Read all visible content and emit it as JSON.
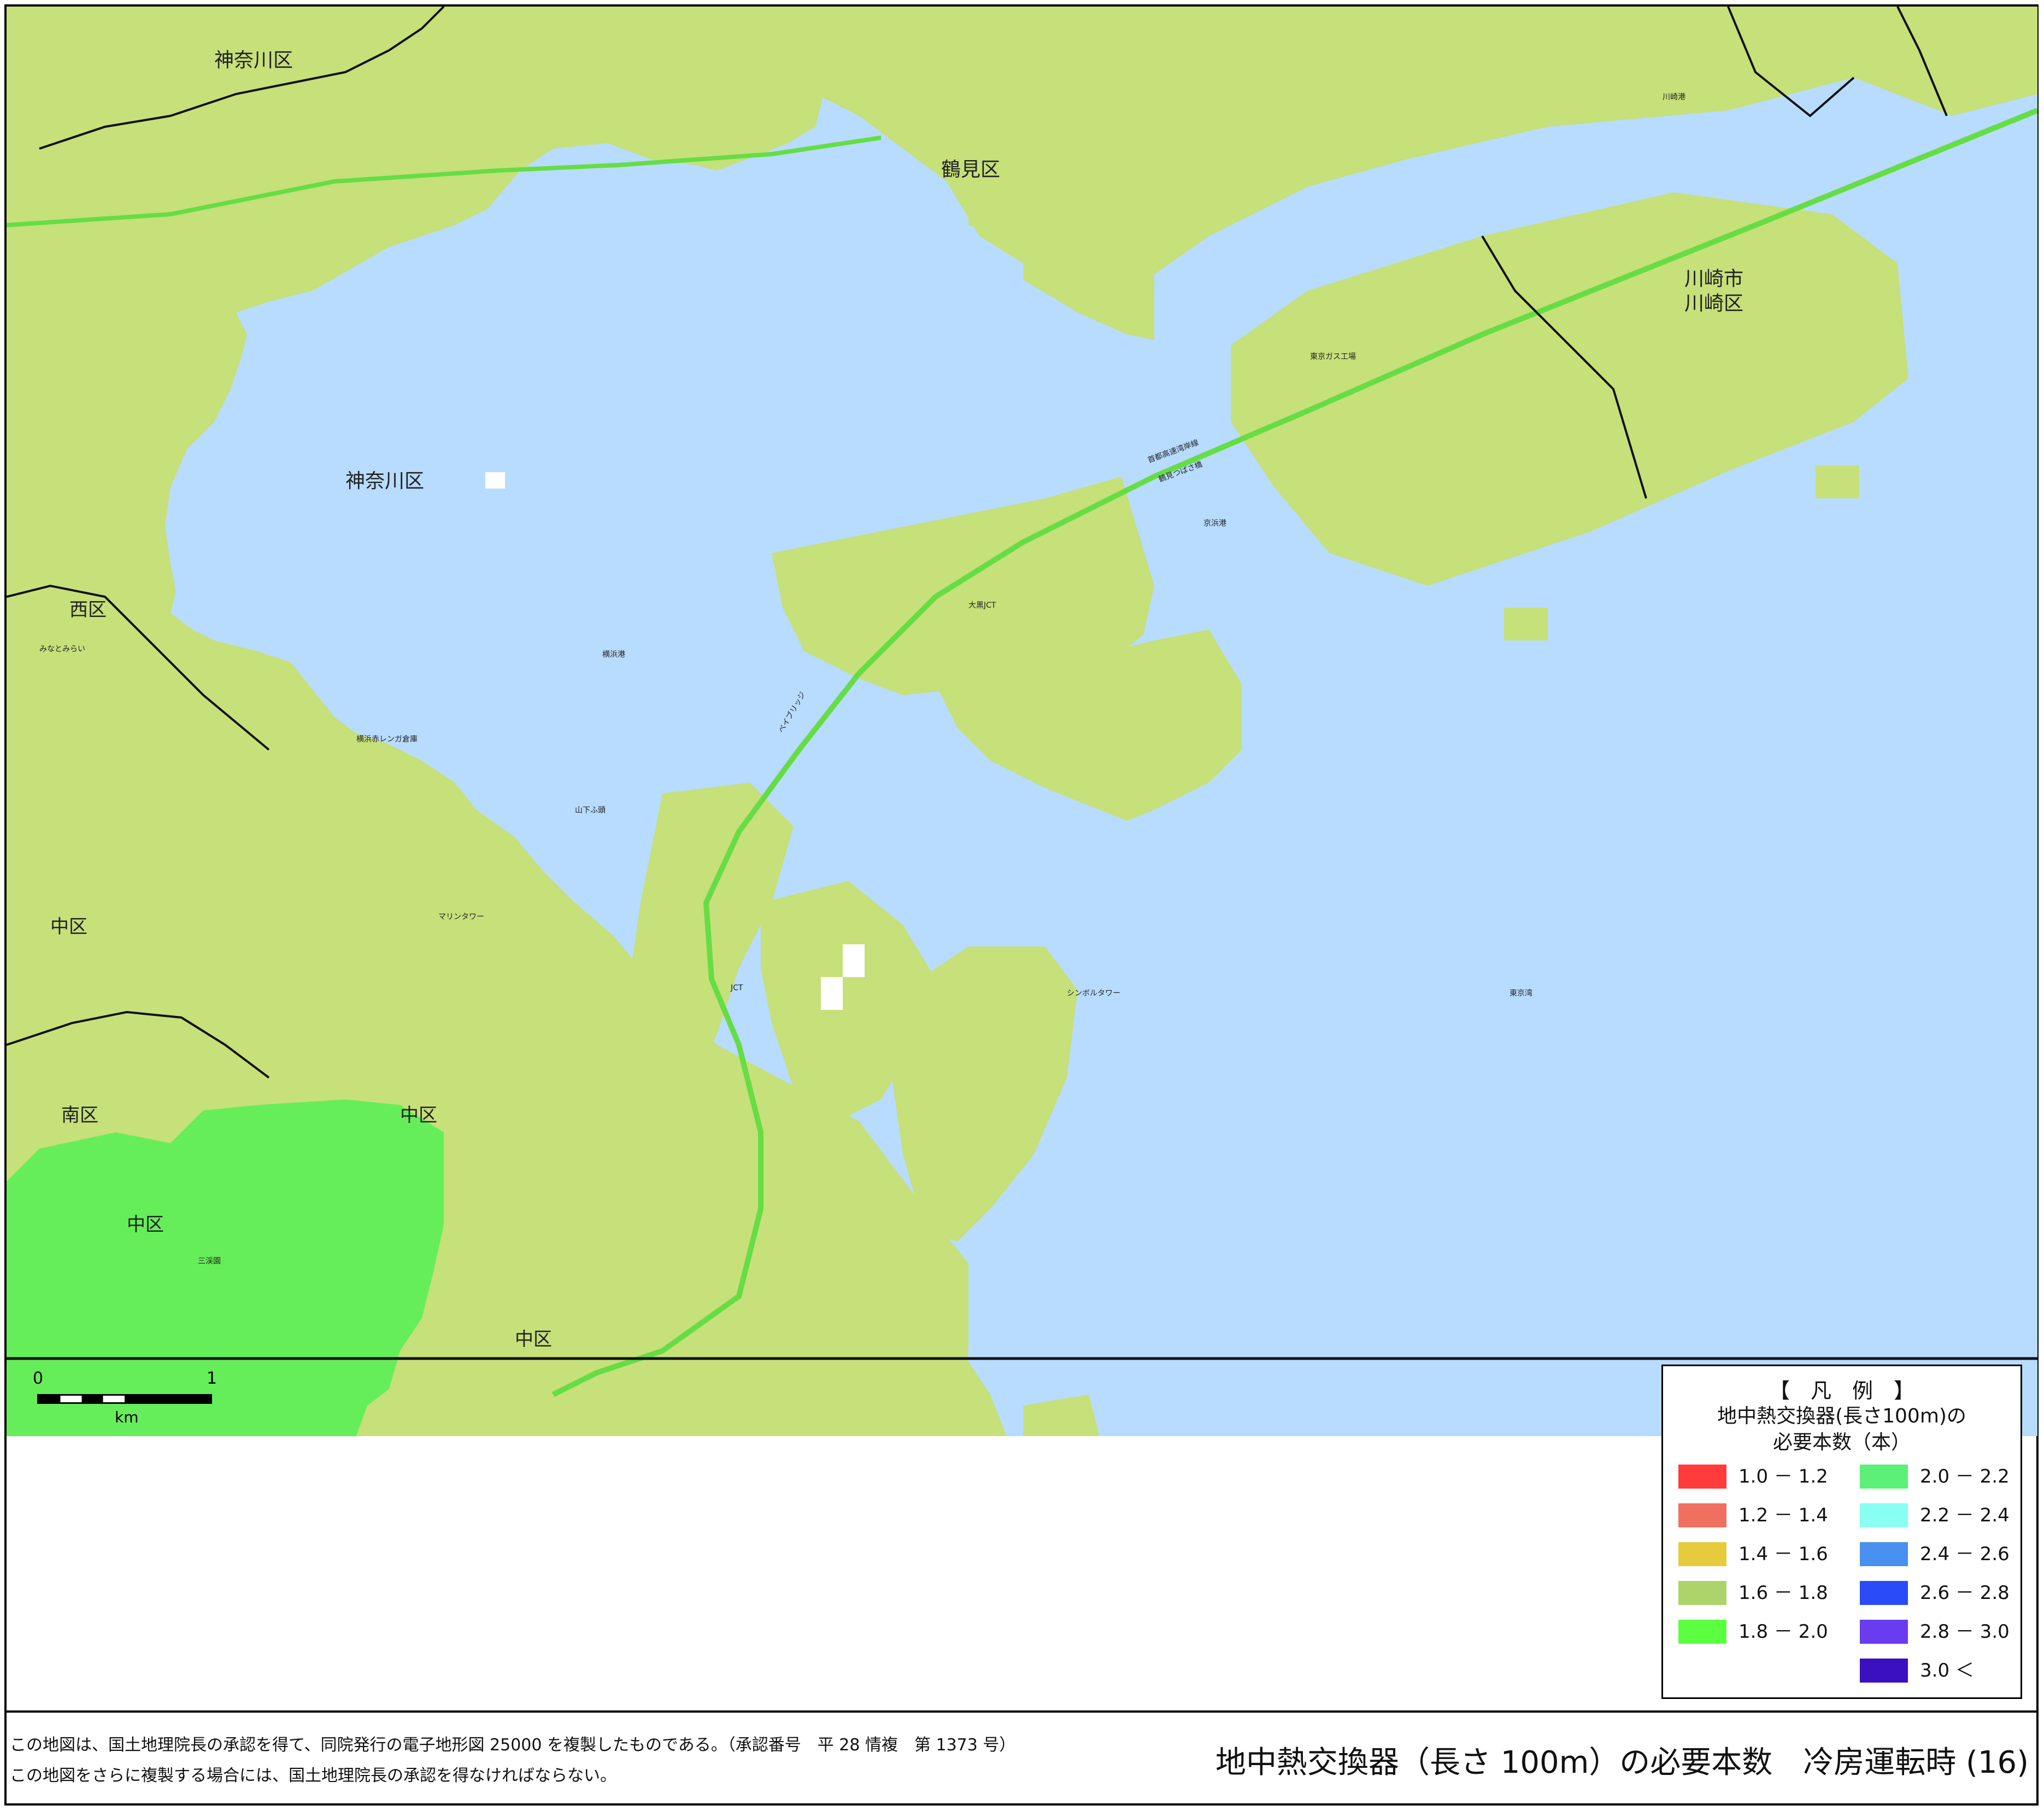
{
  "map": {
    "colors": {
      "land": "#c6e07a",
      "water": "#b7dcff",
      "zone_green": "#66ee5a",
      "boundary": "#111111",
      "expressway": "#66dd44"
    },
    "place_labels": {
      "kanagawa_north": "神奈川区",
      "kanagawa_port": "神奈川区",
      "tsurumi": "鶴見区",
      "kawasaki_city": "川崎市",
      "kawasaki_ward": "川崎区",
      "nishi": "西区",
      "naka_west": "中区",
      "minami": "南区",
      "naka_mid": "中区",
      "naka_park": "中区",
      "naka_south": "中区"
    },
    "small_labels": {
      "tokyo_bay": "東京湾",
      "keihin_port": "京浜港",
      "yokohama_port": "横浜港",
      "bay_bridge": "ベイブリッジ",
      "marine_tower": "マリンタワー",
      "symbol_tower": "シンボルタワー",
      "daikoku_jct": "大黒JCT",
      "honmoku_jct": "JCT",
      "shuto_bayshore": "首都高速湾岸線",
      "tsubasa_bridge": "鶴見つばさ橋",
      "kawasaki_port": "川崎港",
      "tokyo_gas": "東京ガス工場",
      "yamashita_pier": "山下ふ頭",
      "red_brick": "横浜赤レンガ倉庫",
      "minato_mirai": "みなとみらい",
      "sankeien": "三渓園"
    }
  },
  "scale": {
    "min": "0",
    "max": "1",
    "unit": "km"
  },
  "legend": {
    "bracket": "【　凡　例　】",
    "title_line1": "地中熱交換器(長さ100m)の",
    "title_line2": "必要本数（本）",
    "items_left": [
      {
        "label": "1.0 － 1.2",
        "color": "#ff3b3b"
      },
      {
        "label": "1.2 － 1.4",
        "color": "#f07060"
      },
      {
        "label": "1.4 － 1.6",
        "color": "#e6cc3c"
      },
      {
        "label": "1.6 － 1.8",
        "color": "#acd46a"
      },
      {
        "label": "1.8 － 2.0",
        "color": "#5cff40"
      }
    ],
    "items_right": [
      {
        "label": "2.0 － 2.2",
        "color": "#5cf078"
      },
      {
        "label": "2.2 － 2.4",
        "color": "#88fff0"
      },
      {
        "label": "2.4 － 2.6",
        "color": "#4a90f0"
      },
      {
        "label": "2.6 － 2.8",
        "color": "#2a4cf8"
      },
      {
        "label": "2.8 － 3.0",
        "color": "#6a3cf0"
      },
      {
        "label": "3.0 ＜",
        "color": "#3a10c0"
      }
    ]
  },
  "footer": {
    "note_line1": "この地図は、国土地理院長の承認を得て、同院発行の電子地形図 25000 を複製したものである。（承認番号　平 28 情複　第 1373 号）",
    "note_line2": "この地図をさらに複製する場合には、国土地理院長の承認を得なければならない。",
    "map_title": "地中熱交換器（長さ 100m）の必要本数　冷房運転時 (16)"
  }
}
